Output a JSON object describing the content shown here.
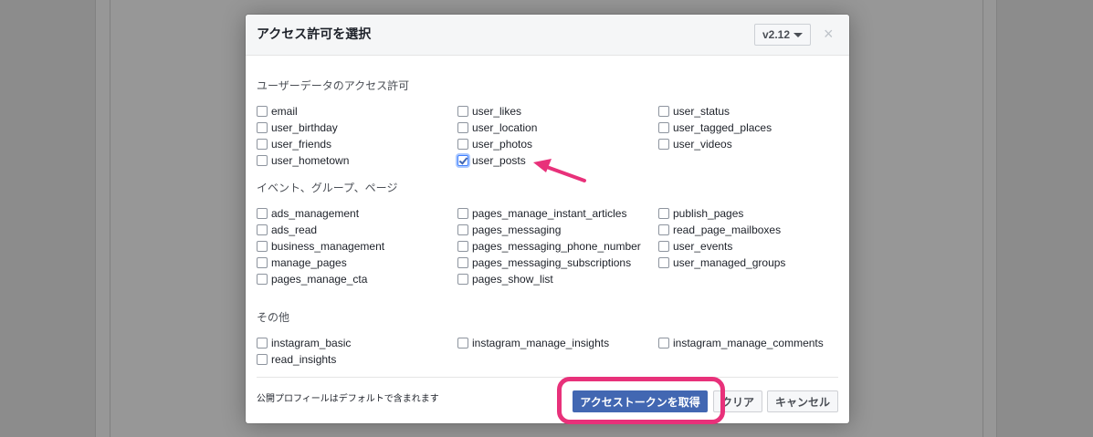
{
  "modal": {
    "title": "アクセス許可を選択",
    "version": "v2.12",
    "close_symbol": "×"
  },
  "sections": [
    {
      "title": "ユーザーデータのアクセス許可",
      "columns": [
        [
          "email",
          "user_birthday",
          "user_friends",
          "user_hometown"
        ],
        [
          "user_likes",
          "user_location",
          "user_photos",
          "user_posts"
        ],
        [
          "user_status",
          "user_tagged_places",
          "user_videos"
        ]
      ]
    },
    {
      "title": "イベント、グループ、ページ",
      "columns": [
        [
          "ads_management",
          "ads_read",
          "business_management",
          "manage_pages",
          "pages_manage_cta"
        ],
        [
          "pages_manage_instant_articles",
          "pages_messaging",
          "pages_messaging_phone_number",
          "pages_messaging_subscriptions",
          "pages_show_list"
        ],
        [
          "publish_pages",
          "read_page_mailboxes",
          "user_events",
          "user_managed_groups"
        ]
      ]
    },
    {
      "title": "その他",
      "columns": [
        [
          "instagram_basic",
          "read_insights"
        ],
        [
          "instagram_manage_insights"
        ],
        [
          "instagram_manage_comments"
        ]
      ]
    }
  ],
  "checked_permissions": [
    "user_posts"
  ],
  "footer": {
    "note": "公開プロフィールはデフォルトで含まれます",
    "get_token_label": "アクセストークンを取得",
    "clear_label": "クリア",
    "cancel_label": "キャンセル"
  },
  "colors": {
    "primary_button": "#4267b2",
    "annotation_pink": "#e8317a"
  }
}
